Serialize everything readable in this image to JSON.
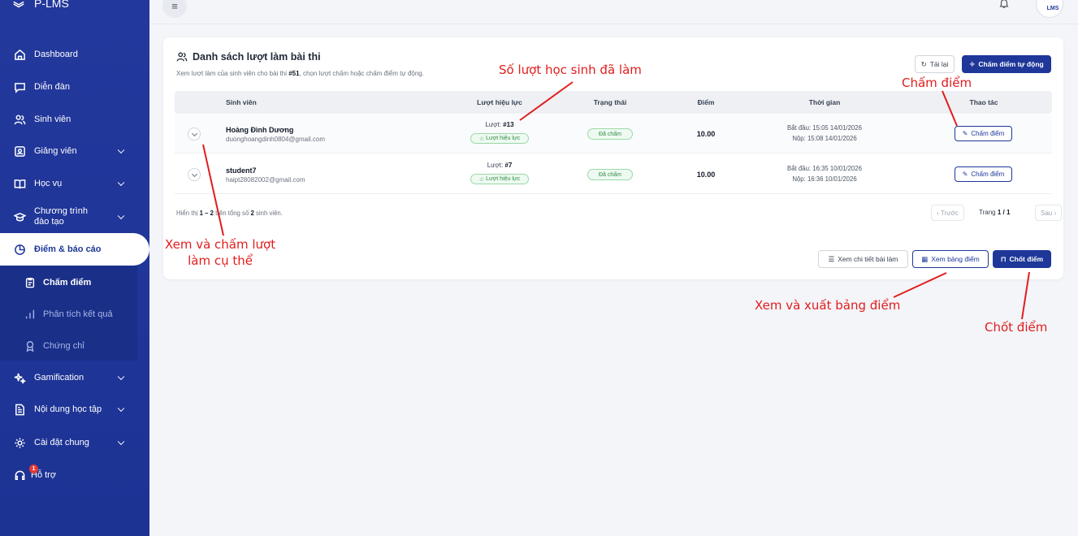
{
  "app": {
    "name": "P-LMS"
  },
  "sidebar": {
    "items": [
      {
        "label": "Dashboard",
        "icon": "home-icon"
      },
      {
        "label": "Diễn đàn",
        "icon": "chat-icon"
      },
      {
        "label": "Sinh viên",
        "icon": "users-icon"
      },
      {
        "label": "Giảng viên",
        "icon": "id-card-icon"
      },
      {
        "label": "Học vụ",
        "icon": "book-icon"
      },
      {
        "label_line1": "Chương trình",
        "label_line2": "đào tạo",
        "icon": "graduation-cap-icon"
      },
      {
        "label": "Điểm & báo cáo",
        "icon": "pie-chart-icon"
      },
      {
        "label": "Gamification",
        "icon": "sparkle-icon"
      },
      {
        "label": "Nội dung học tập",
        "icon": "file-icon"
      },
      {
        "label": "Cài đặt chung",
        "icon": "gear-icon"
      },
      {
        "label": "Hỗ trợ",
        "icon": "headset-icon",
        "badge": "1"
      }
    ],
    "sub_items": [
      {
        "label": "Chấm điểm",
        "icon": "clipboard-icon"
      },
      {
        "label": "Phân tích kết quả",
        "icon": "bar-chart-icon"
      },
      {
        "label": "Chứng chỉ",
        "icon": "award-icon"
      }
    ]
  },
  "topbar": {
    "menu_glyph": "≡",
    "logo_text": "LMS"
  },
  "card": {
    "title": "Danh sách lượt làm bài thi",
    "subtitle_pre": "Xem lượt làm của sinh viên cho bài thi ",
    "exam_id": "#51",
    "subtitle_post": ", chọn lượt chấm hoặc chấm điểm tự động.",
    "reload_label": "Tải lại",
    "auto_grade_label": "Chấm điểm tự động"
  },
  "table": {
    "headers": [
      "Sinh viên",
      "Lượt hiệu lực",
      "Trạng thái",
      "Điểm",
      "Thời gian",
      "Thao tác"
    ],
    "rows": [
      {
        "name": "Hoàng Đình Dương",
        "email": "duonghoangdinh0804@gmail.com",
        "attempt_prefix": "Lượt: ",
        "attempt": "#13",
        "valid_label": "Lượt hiệu lực",
        "status": "Đã chấm",
        "score": "10.00",
        "start": "Bắt đầu: 15:05 14/01/2026",
        "submit": "Nộp: 15:08 14/01/2026",
        "action": "Chấm điểm"
      },
      {
        "name": "student7",
        "email": "haipt28082002@gmail.com",
        "attempt_prefix": "Lượt: ",
        "attempt": "#7",
        "valid_label": "Lượt hiệu lực",
        "status": "Đã chấm",
        "score": "10.00",
        "start": "Bắt đầu: 16:35 10/01/2026",
        "submit": "Nộp: 16:36 10/01/2026",
        "action": "Chấm điểm"
      }
    ]
  },
  "footer": {
    "info_pre": "Hiển thị ",
    "range": "1 – 2",
    "info_mid": " trên tổng số ",
    "total": "2",
    "info_post": " sinh viên.",
    "prev": "Trước",
    "page_pre": "Trang ",
    "page": "1 / 1",
    "next": "Sau"
  },
  "actions": {
    "view_detail": "Xem chi tiết bài làm",
    "view_sheet": "Xem bảng điểm",
    "finalize": "Chốt điểm"
  },
  "annotations": {
    "attempt_count": "Số lượt học sinh đã làm",
    "grade": "Chấm điểm",
    "view_attempt_line1": "Xem và chấm lượt",
    "view_attempt_line2": "làm cụ thể",
    "export_sheet": "Xem  và xuất bảng điểm",
    "finalize": "Chốt điểm",
    "color": "#e11d1d"
  },
  "colors": {
    "sidebar": "#1e3799",
    "primary": "#1e3799",
    "success": "#2e8b46"
  }
}
